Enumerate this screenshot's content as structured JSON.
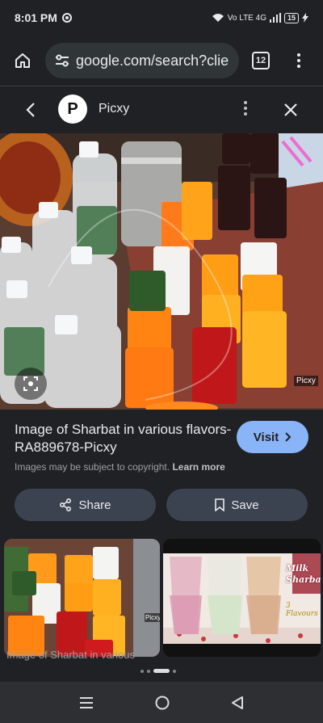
{
  "status": {
    "time": "8:01 PM",
    "network": "Vo LTE 4G",
    "battery": "15"
  },
  "browser": {
    "url": "google.com/search?clien",
    "tab_count": "12"
  },
  "viewer": {
    "site_name": "Picxy",
    "site_logo_letter": "P",
    "image_watermark": "Picxy",
    "title": "Image of Sharbat in various flavors-RA889678-Picxy",
    "visit_label": "Visit",
    "copyright_prefix": "Images may be subject to copyright.",
    "learn_more": "Learn more",
    "share_label": "Share",
    "save_label": "Save",
    "related_1_watermark": "Picxy",
    "related_2_text": "Milk Sharbat",
    "related_2_subtext": "3 Flavours",
    "related_caption": "Image of Sharbat in various"
  },
  "colors": {
    "accent": "#8ab4f8",
    "background": "#202124",
    "button": "#3c4350"
  },
  "icons": [
    "home-icon",
    "tune-icon",
    "tabs-icon",
    "overflow-menu-icon",
    "back-icon",
    "close-icon",
    "lens-icon",
    "share-icon",
    "bookmark-icon",
    "chevron-right-icon",
    "recents-icon",
    "home-circle-icon",
    "back-triangle-icon"
  ]
}
